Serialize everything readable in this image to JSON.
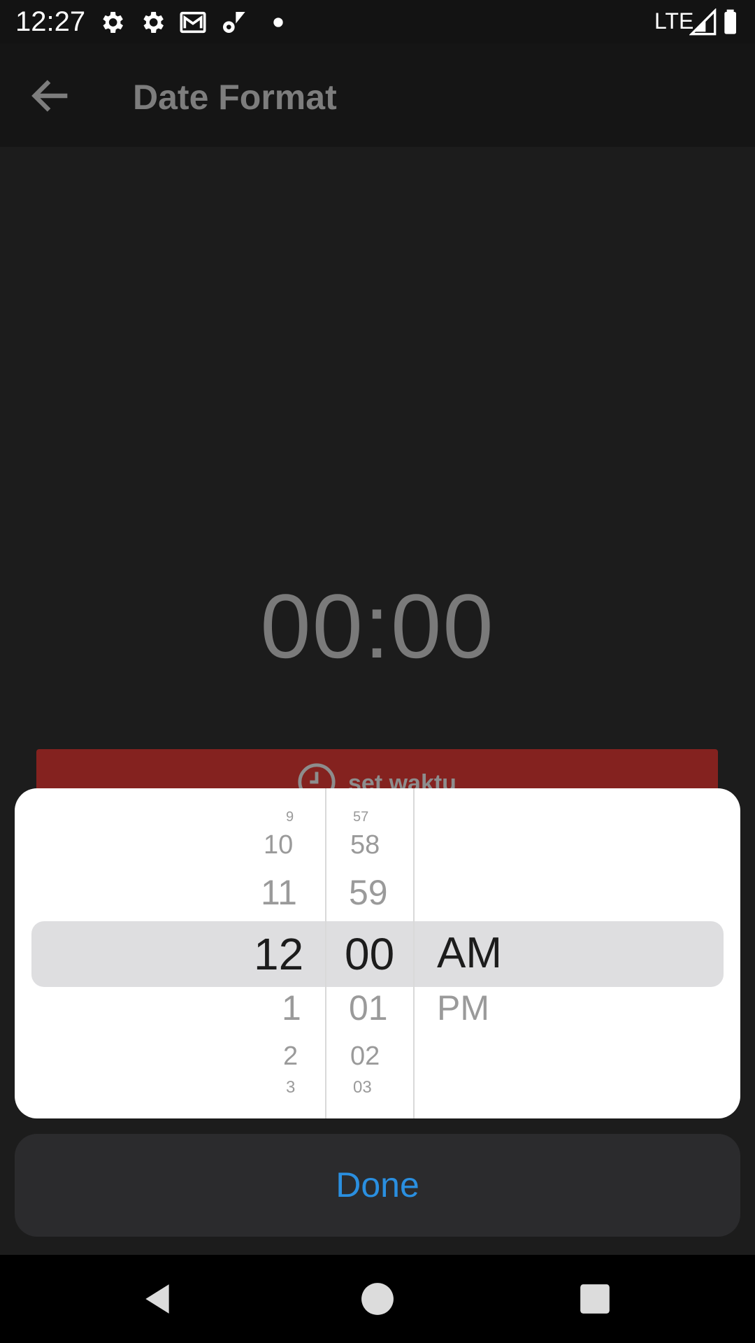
{
  "status_bar": {
    "time": "12:27",
    "network": "LTE",
    "icons": [
      "gear-icon",
      "gear-icon",
      "gmail-icon",
      "wifi-settings-icon",
      "notification-dot-icon",
      "signal-icon",
      "battery-icon"
    ]
  },
  "app_bar": {
    "title": "Date Format",
    "back_icon": "arrow-back-icon"
  },
  "main": {
    "time_display": "00:00",
    "set_time_button": {
      "label": "set waktu",
      "icon": "clock-icon",
      "color": "#84221f"
    }
  },
  "time_picker": {
    "hours": [
      "9",
      "10",
      "11",
      "12",
      "1",
      "2",
      "3"
    ],
    "minutes": [
      "57",
      "58",
      "59",
      "00",
      "01",
      "02",
      "03"
    ],
    "period": [
      "AM",
      "PM"
    ],
    "selected": {
      "hour": "12",
      "minute": "00",
      "period": "AM"
    }
  },
  "done_button": {
    "label": "Done",
    "color": "#2a8fe0"
  },
  "nav_bar": {
    "icons": [
      "nav-back-icon",
      "nav-home-icon",
      "nav-recents-icon"
    ]
  }
}
